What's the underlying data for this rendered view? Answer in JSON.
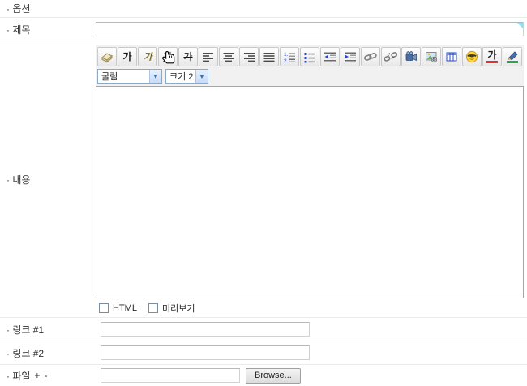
{
  "form": {
    "rows": [
      {
        "id": "option",
        "label": "· 옵션"
      },
      {
        "id": "title",
        "label": "· 제목",
        "input_value": ""
      },
      {
        "id": "content",
        "label": "· 내용"
      },
      {
        "id": "link1",
        "label": "· 링크 #1",
        "input_value": ""
      },
      {
        "id": "link2",
        "label": "· 링크 #2",
        "input_value": ""
      },
      {
        "id": "file",
        "label": "· 파일",
        "add_label": "+",
        "remove_label": "-",
        "input_value": "",
        "browse_label": "Browse..."
      }
    ]
  },
  "editor": {
    "toolbar_buttons": [
      {
        "name": "remove-format-button",
        "glyph": ""
      },
      {
        "name": "bold-button",
        "glyph": "가"
      },
      {
        "name": "italic-button",
        "glyph": "가"
      },
      {
        "name": "underline-button",
        "glyph": "가"
      },
      {
        "name": "strikethrough-button",
        "glyph": "가"
      },
      {
        "name": "align-left-button",
        "glyph": ""
      },
      {
        "name": "align-center-button",
        "glyph": ""
      },
      {
        "name": "align-right-button",
        "glyph": ""
      },
      {
        "name": "align-justify-button",
        "glyph": ""
      },
      {
        "name": "ordered-list-button",
        "glyph": ""
      },
      {
        "name": "unordered-list-button",
        "glyph": ""
      },
      {
        "name": "outdent-button",
        "glyph": ""
      },
      {
        "name": "indent-button",
        "glyph": ""
      },
      {
        "name": "link-button",
        "glyph": ""
      },
      {
        "name": "unlink-button",
        "glyph": ""
      },
      {
        "name": "media-button",
        "glyph": ""
      },
      {
        "name": "image-button",
        "glyph": ""
      },
      {
        "name": "table-button",
        "glyph": ""
      },
      {
        "name": "emoticon-button",
        "glyph": ""
      },
      {
        "name": "font-color-button",
        "glyph": "가"
      },
      {
        "name": "highlight-button",
        "glyph": ""
      }
    ],
    "font_select_value": "굴림",
    "size_select_value": "크기 2",
    "select_arrow": "▼",
    "checkbox_html_label": "HTML",
    "checkbox_preview_label": "미리보기",
    "content_value": ""
  },
  "colors": {
    "toolbar_bg": "#f1f1f1",
    "select_arrow_bg": "#c6dcf8",
    "font_color_bar": "#e03131",
    "highlight_bar": "#2da44e",
    "tooltip_corner": "#90dcf4",
    "divider": "#ececec"
  }
}
